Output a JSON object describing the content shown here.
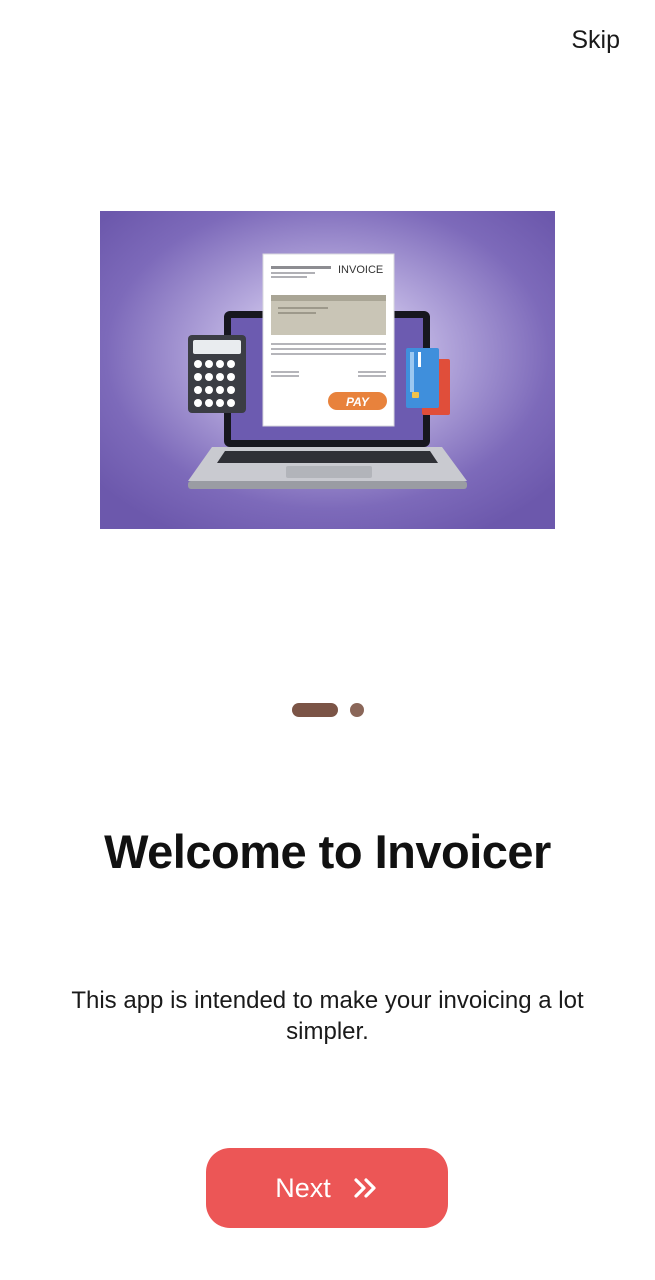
{
  "header": {
    "skip_label": "Skip"
  },
  "hero": {
    "invoice_label": "INVOICE",
    "pay_label": "PAY",
    "icon": "laptop-invoice-illustration"
  },
  "pager": {
    "total": 2,
    "current": 1
  },
  "content": {
    "title": "Welcome to Invoicer",
    "subtitle": "This app is intended to make your invoicing a lot simpler."
  },
  "footer": {
    "next_label": "Next",
    "next_icon": "double-chevron-right-icon"
  },
  "colors": {
    "accent": "#ec5656",
    "indicator": "#7b5446",
    "hero_background": "#7a66b8"
  }
}
